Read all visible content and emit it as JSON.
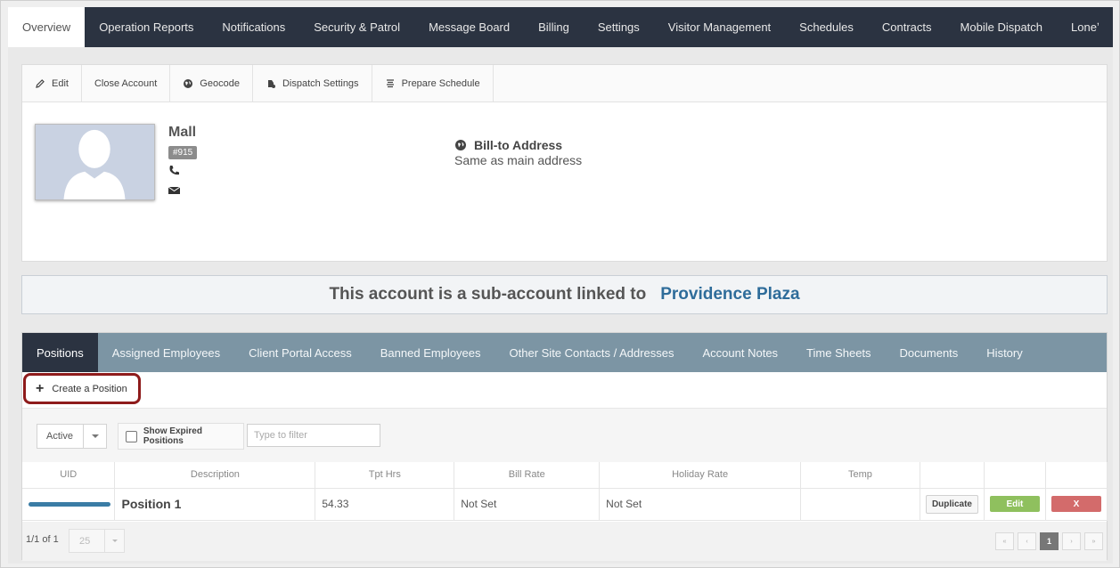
{
  "topnav": {
    "tabs": [
      {
        "label": "Overview",
        "active": true
      },
      {
        "label": "Operation Reports"
      },
      {
        "label": "Notifications"
      },
      {
        "label": "Security & Patrol"
      },
      {
        "label": "Message Board"
      },
      {
        "label": "Billing"
      },
      {
        "label": "Settings"
      },
      {
        "label": "Visitor Management"
      },
      {
        "label": "Schedules"
      },
      {
        "label": "Contracts"
      },
      {
        "label": "Mobile Dispatch"
      },
      {
        "label": "Loneʼ"
      }
    ]
  },
  "toolbar": {
    "edit": "Edit",
    "close_account": "Close Account",
    "geocode": "Geocode",
    "dispatch_settings": "Dispatch Settings",
    "prepare_schedule": "Prepare Schedule"
  },
  "account": {
    "name": "Mall",
    "badge": "#915",
    "bill_to_title": "Bill-to Address",
    "bill_to_value": "Same as main address"
  },
  "banner": {
    "text": "This account is a sub-account linked to",
    "link": "Providence Plaza"
  },
  "subtabs": [
    {
      "label": "Positions",
      "active": true
    },
    {
      "label": "Assigned Employees"
    },
    {
      "label": "Client Portal Access"
    },
    {
      "label": "Banned Employees"
    },
    {
      "label": "Other Site Contacts / Addresses"
    },
    {
      "label": "Account Notes"
    },
    {
      "label": "Time Sheets"
    },
    {
      "label": "Documents"
    },
    {
      "label": "History"
    }
  ],
  "positions": {
    "create_label": "Create a Position",
    "status_select": "Active",
    "show_expired_label": "Show Expired Positions",
    "filter_placeholder": "Type to filter",
    "columns": [
      "UID",
      "Description",
      "Tpt Hrs",
      "Bill Rate",
      "Holiday Rate",
      "Temp"
    ],
    "rows": [
      {
        "description": "Position 1",
        "tpt_hrs": "54.33",
        "bill_rate": "Not Set",
        "holiday_rate": "Not Set",
        "temp": "",
        "duplicate_label": "Duplicate",
        "edit_label": "Edit",
        "delete_label": "X"
      }
    ],
    "page_info": "1/1 of 1",
    "page_size": "25",
    "current_page": "1"
  }
}
